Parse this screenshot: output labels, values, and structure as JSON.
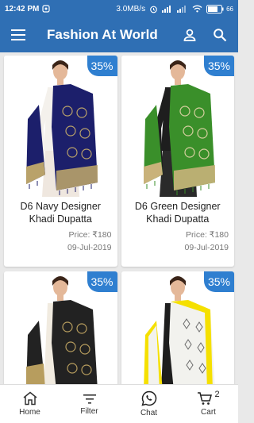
{
  "status": {
    "time": "12:42 PM",
    "net_speed": "3.0MB/s",
    "battery": "66"
  },
  "header": {
    "title": "Fashion At World",
    "icons": [
      "menu-icon",
      "account-icon",
      "search-icon"
    ]
  },
  "products": [
    {
      "discount": "35%",
      "title": "D6 Navy Designer Khadi Dupatta",
      "price": "Price: ₹180",
      "date": "09-Jul-2019",
      "colors": {
        "main": "#1c1f6b",
        "pattern": "#b9a26a",
        "border": "#c9b27a"
      }
    },
    {
      "discount": "35%",
      "title": "D6 Green Designer Khadi Dupatta",
      "price": "Price: ₹180",
      "date": "09-Jul-2019",
      "colors": {
        "main": "#3a8f2a",
        "pattern": "#d7cfa0",
        "border": "#c9b27a"
      }
    },
    {
      "discount": "35%",
      "title": "",
      "price": "",
      "date": "",
      "colors": {
        "main": "#222222",
        "pattern": "#b79d5e",
        "border": "#c9b27a"
      }
    },
    {
      "discount": "35%",
      "title": "",
      "price": "",
      "date": "",
      "colors": {
        "main": "#f2f2ee",
        "pattern": "#6a6a6a",
        "border": "#f5e000"
      }
    }
  ],
  "bottom_nav": {
    "home": "Home",
    "filter": "Filter",
    "chat": "Chat",
    "cart": "Cart",
    "cart_count": "2"
  },
  "colors": {
    "primary": "#2f6fb4",
    "badge": "#2f7fd0"
  }
}
